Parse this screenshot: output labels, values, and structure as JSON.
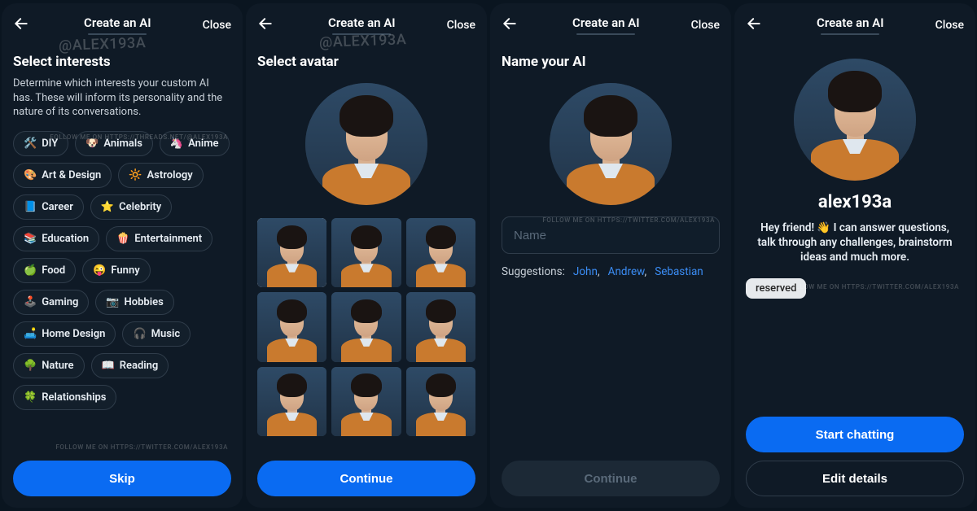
{
  "header": {
    "title": "Create an AI",
    "close": "Close"
  },
  "screen1": {
    "title": "Select interests",
    "desc": "Determine which interests your custom AI has. These will inform its personality and the nature of its conversations.",
    "chips": [
      {
        "emoji": "🛠️",
        "label": "DIY"
      },
      {
        "emoji": "🐶",
        "label": "Animals"
      },
      {
        "emoji": "🦄",
        "label": "Anime"
      },
      {
        "emoji": "🎨",
        "label": "Art & Design"
      },
      {
        "emoji": "🔆",
        "label": "Astrology"
      },
      {
        "emoji": "📘",
        "label": "Career"
      },
      {
        "emoji": "⭐",
        "label": "Celebrity"
      },
      {
        "emoji": "📚",
        "label": "Education"
      },
      {
        "emoji": "🍿",
        "label": "Entertainment"
      },
      {
        "emoji": "🍏",
        "label": "Food"
      },
      {
        "emoji": "😜",
        "label": "Funny"
      },
      {
        "emoji": "🕹️",
        "label": "Gaming"
      },
      {
        "emoji": "📷",
        "label": "Hobbies"
      },
      {
        "emoji": "🛋️",
        "label": "Home Design"
      },
      {
        "emoji": "🎧",
        "label": "Music"
      },
      {
        "emoji": "🌳",
        "label": "Nature"
      },
      {
        "emoji": "📖",
        "label": "Reading"
      },
      {
        "emoji": "🍀",
        "label": "Relationships"
      }
    ],
    "button": "Skip"
  },
  "screen2": {
    "title": "Select avatar",
    "button": "Continue"
  },
  "screen3": {
    "title": "Name your AI",
    "placeholder": "Name",
    "suggestLabel": "Suggestions:",
    "suggestions": [
      "John",
      "Andrew",
      "Sebastian"
    ],
    "button": "Continue"
  },
  "screen4": {
    "aiName": "alex193a",
    "intro": "Hey friend! 👋 I can answer questions, talk through any challenges, brainstorm ideas and much more.",
    "tag": "reserved",
    "primary": "Start chatting",
    "secondary": "Edit details"
  },
  "watermarks": {
    "threads": "FOLLOW ME ON HTTPS://THREADS.NET/@ALEX193A",
    "twitter": "FOLLOW ME ON HTTPS://TWITTER.COM/ALEX193A",
    "handle": "@ALEX193A"
  }
}
